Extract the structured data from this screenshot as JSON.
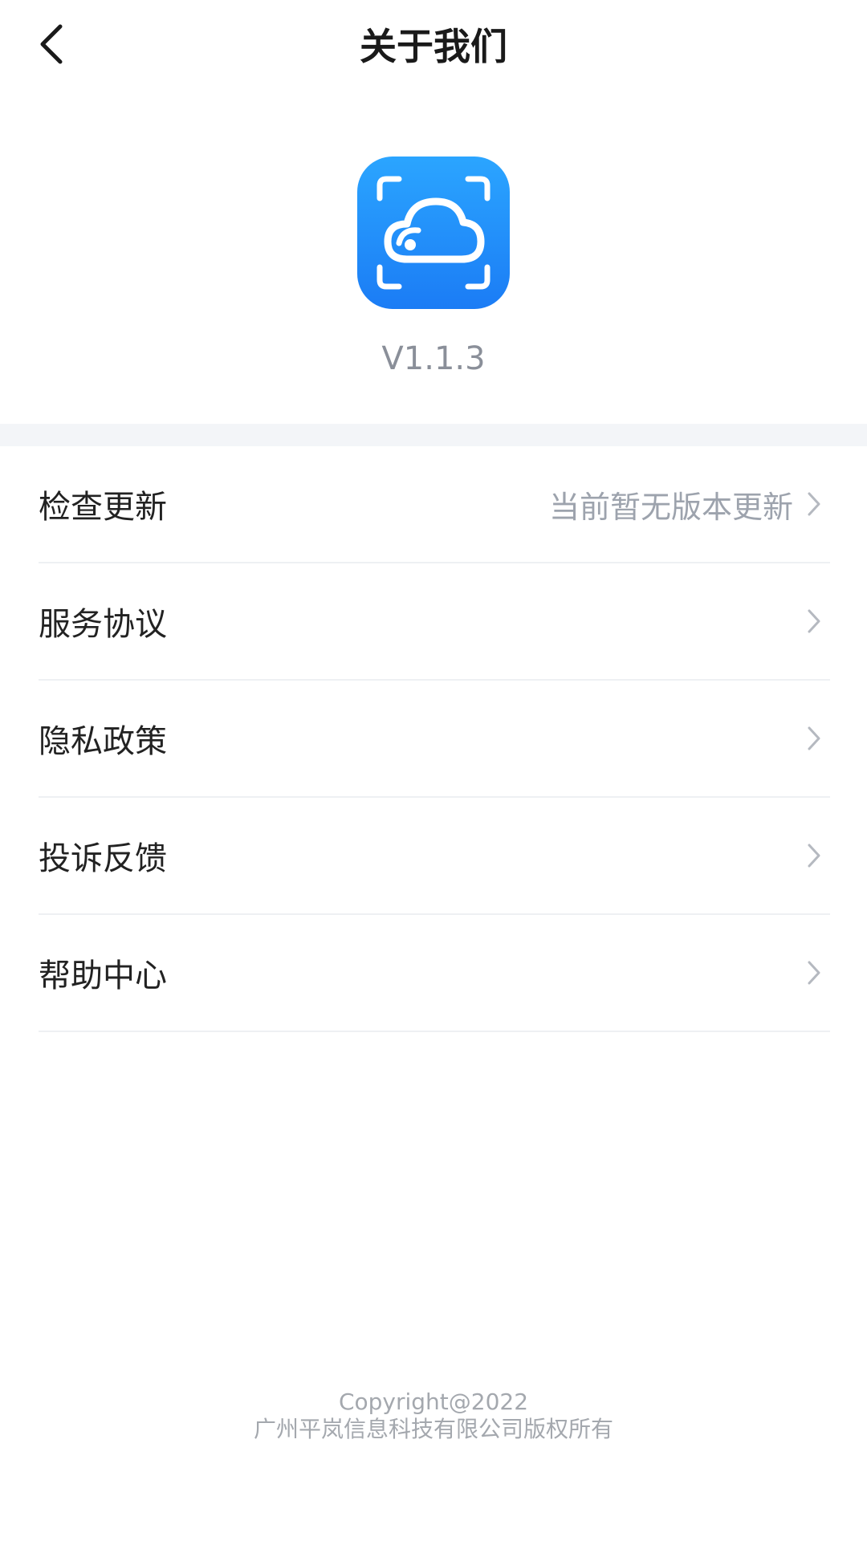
{
  "header": {
    "title": "关于我们",
    "back_icon": "chevron-left-icon"
  },
  "app": {
    "icon": "cloud-scan-app-icon",
    "version": "V1.1.3",
    "brand_color": "#1e88ff"
  },
  "menu": {
    "items": [
      {
        "label": "检查更新",
        "value": "当前暂无版本更新"
      },
      {
        "label": "服务协议",
        "value": ""
      },
      {
        "label": "隐私政策",
        "value": ""
      },
      {
        "label": "投诉反馈",
        "value": ""
      },
      {
        "label": "帮助中心",
        "value": ""
      }
    ]
  },
  "footer": {
    "copyright": "Copyright@2022",
    "company": "广州平岚信息科技有限公司版权所有"
  }
}
